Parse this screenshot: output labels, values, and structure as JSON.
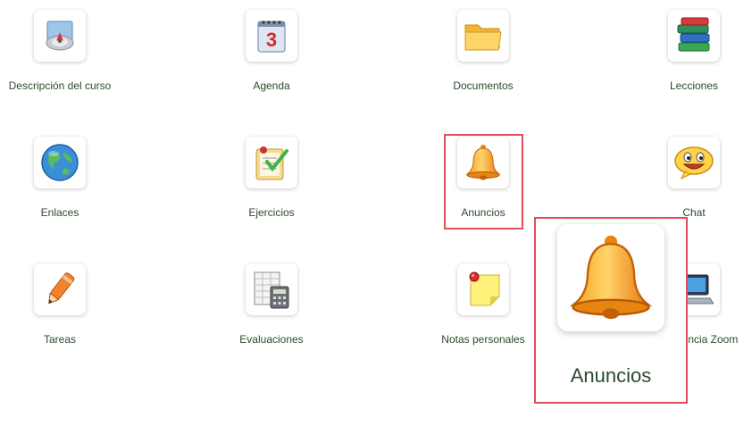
{
  "tools": [
    {
      "label": "Descripción del curso",
      "icon": "course-description-icon"
    },
    {
      "label": "Agenda",
      "icon": "calendar-icon",
      "calendar_day": "3"
    },
    {
      "label": "Documentos",
      "icon": "folder-icon"
    },
    {
      "label": "Lecciones",
      "icon": "books-icon"
    },
    {
      "label": "Enlaces",
      "icon": "globe-icon"
    },
    {
      "label": "Ejercicios",
      "icon": "checklist-icon"
    },
    {
      "label": "Anuncios",
      "icon": "bell-icon"
    },
    {
      "label": "Chat",
      "icon": "chat-smiley-icon"
    },
    {
      "label": "Tareas",
      "icon": "pencil-icon"
    },
    {
      "label": "Evaluaciones",
      "icon": "calculator-sheet-icon"
    },
    {
      "label": "Notas personales",
      "icon": "sticky-note-icon"
    },
    {
      "label": "Conferencia Zoom",
      "icon": "laptop-icon"
    }
  ],
  "highlight": {
    "label": "Anuncios",
    "icon": "bell-icon"
  },
  "colors": {
    "label_text": "#2b4a2b",
    "highlight_border": "#e0505a"
  }
}
